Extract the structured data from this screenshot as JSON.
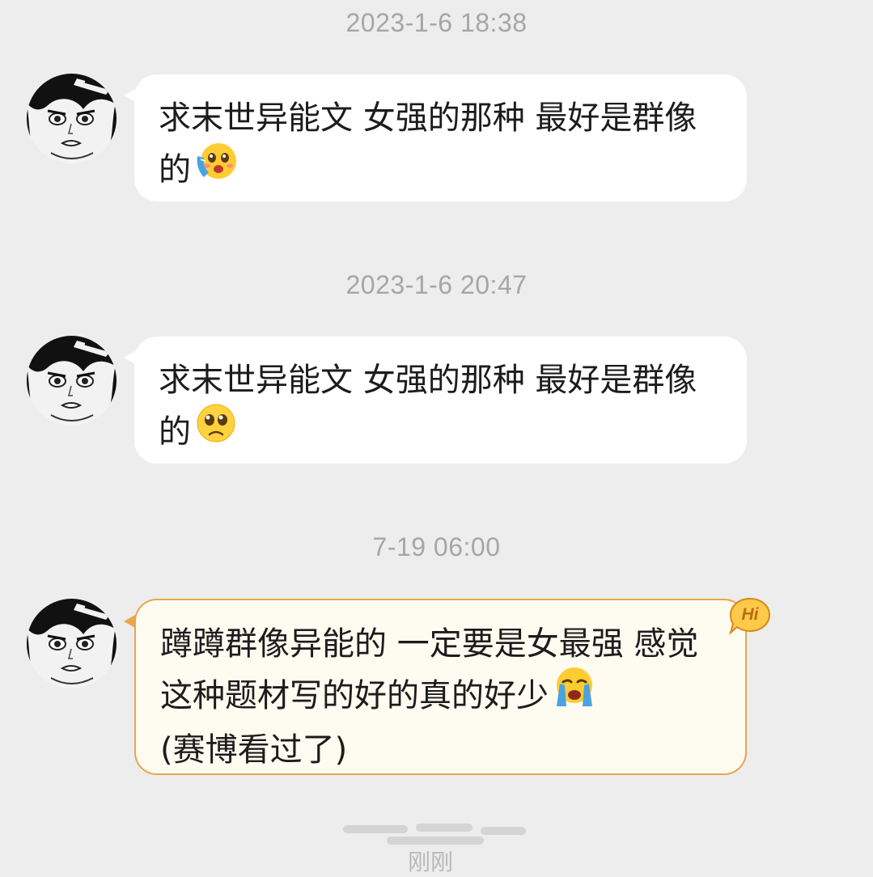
{
  "messages": [
    {
      "timestamp": "2023-1-6 18:38",
      "text": "求末世异能文 女强的那种 最好是群像的",
      "emoji": "face-holding-back-tears-blush-emoji"
    },
    {
      "timestamp": "2023-1-6 20:47",
      "text": "求末世异能文 女强的那种 最好是群像的",
      "emoji": "pleading-sad-face-emoji"
    },
    {
      "timestamp": "7-19 06:00",
      "text": "蹲蹲群像异能的 一定要是女最强 感觉这种题材写的好的真的好少",
      "emoji": "loudly-crying-face-emoji",
      "text_after": "(赛博看过了)",
      "badge": "Hi"
    }
  ],
  "footer": {
    "partial_text": "刚刚"
  },
  "colors": {
    "background": "#ededed",
    "bubble": "#ffffff",
    "highlight_bubble": "#fefbf0",
    "highlight_border": "#e9a64a",
    "timestamp": "#a6a6a6"
  }
}
